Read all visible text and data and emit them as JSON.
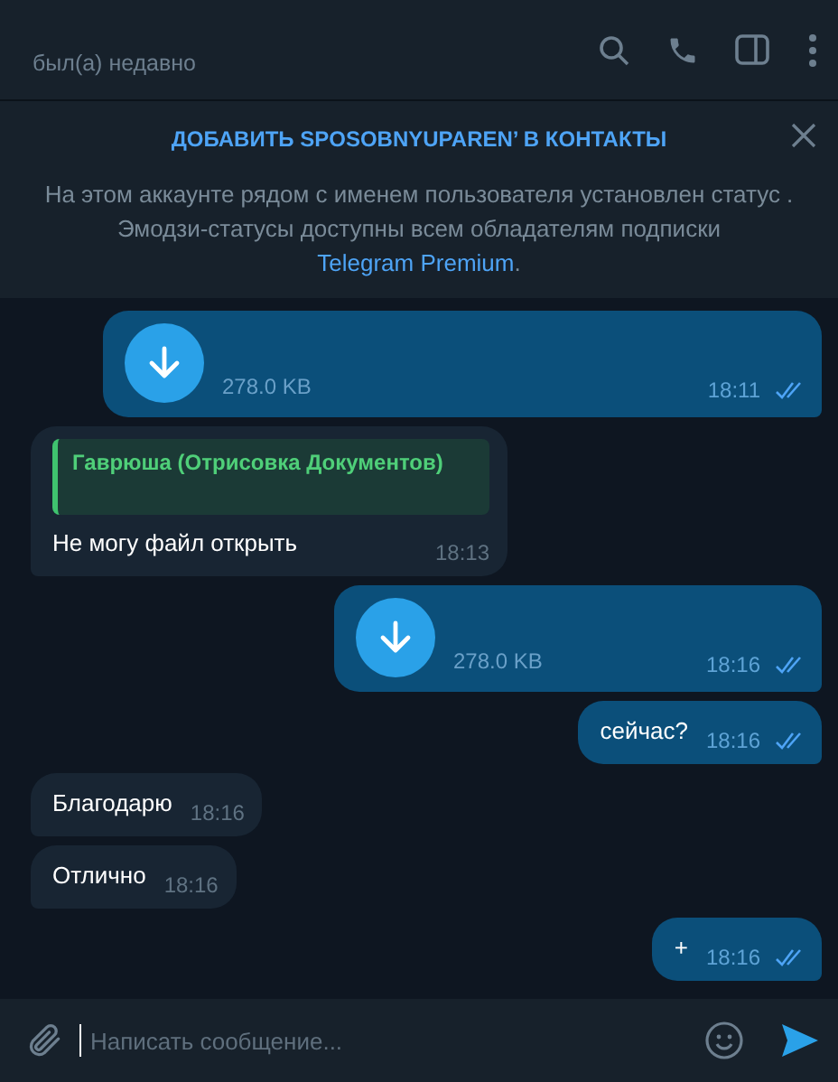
{
  "header": {
    "status": "был(а) недавно"
  },
  "banner": {
    "action": "ДОБАВИТЬ SPOSOBNYUPAREN’ В КОНТАКТЫ",
    "text": "На этом аккаунте рядом с именем пользователя установлен статус . Эмодзи-статусы доступны всем обладателям подписки ",
    "link": "Telegram Premium",
    "tail": "."
  },
  "messages": [
    {
      "kind": "file",
      "outgoing": true,
      "size": "278.0 KB",
      "time": "18:11",
      "read": true
    },
    {
      "kind": "reply",
      "outgoing": false,
      "quote_author": "Гаврюша (Отрисовка Документов)",
      "text": "Не могу файл открыть",
      "time": "18:13"
    },
    {
      "kind": "file",
      "outgoing": true,
      "size": "278.0 KB",
      "time": "18:16",
      "read": true
    },
    {
      "kind": "text",
      "outgoing": true,
      "text": "сейчас?",
      "time": "18:16",
      "read": true
    },
    {
      "kind": "text",
      "outgoing": false,
      "text": "Благодарю",
      "time": "18:16"
    },
    {
      "kind": "text",
      "outgoing": false,
      "text": "Отлично",
      "time": "18:16"
    },
    {
      "kind": "text",
      "outgoing": true,
      "text": "+",
      "time": "18:16",
      "read": true
    }
  ],
  "composer": {
    "placeholder": "Написать сообщение..."
  }
}
